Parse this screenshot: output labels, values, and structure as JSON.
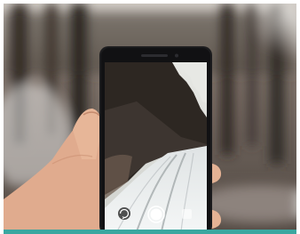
{
  "scene": {
    "subject": "hand-holding-phone",
    "colors": {
      "forest_dark": "#3b3530",
      "forest_mid": "#6b6158",
      "sky": "#e6e7e3",
      "snow": "#e9ecec",
      "skin": "#e4b294",
      "skin_shadow": "#c98f72",
      "phone_body": "#1c1c1e",
      "accent_bar": "#3aa7a0"
    }
  },
  "phone_screen": {
    "mode": "camera-viewfinder",
    "controls": [
      "camera-switch-icon",
      "shutter-button",
      "gallery-icon"
    ]
  }
}
